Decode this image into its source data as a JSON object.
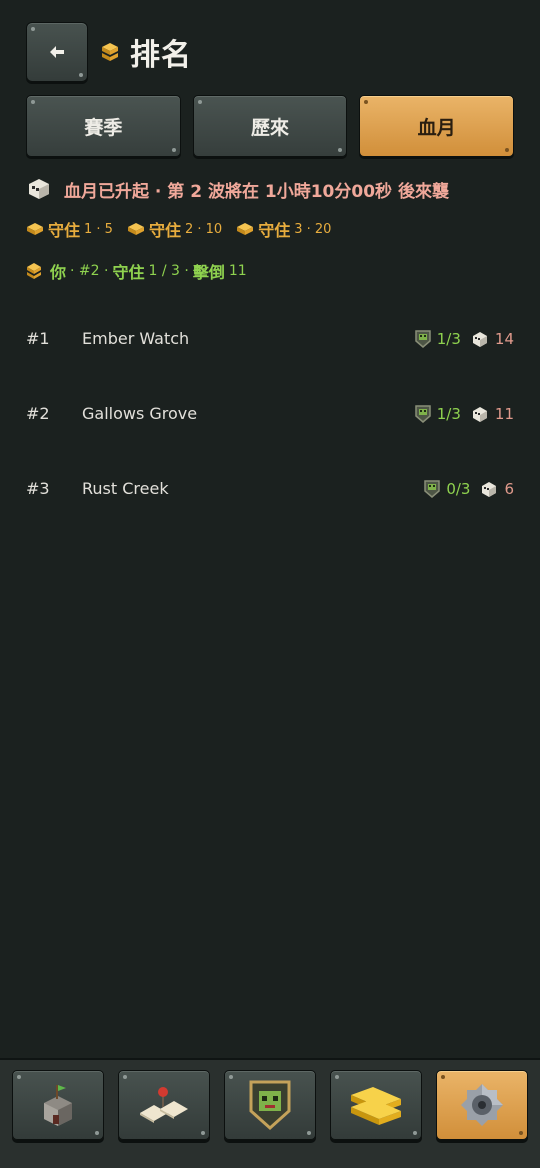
{
  "header": {
    "title": "排名",
    "back_icon": "arrow-left-icon",
    "title_icon": "gold-bar-icon"
  },
  "tabs": [
    {
      "label": "賽季",
      "active": false
    },
    {
      "label": "歷來",
      "active": false
    },
    {
      "label": "血月",
      "active": true
    }
  ],
  "blood_moon": {
    "text": "血月已升起 · 第 2 波將在 1小時10分00秒 後來襲",
    "icon": "skull-icon"
  },
  "rewards": [
    {
      "label": "守住",
      "value": "1 · 5"
    },
    {
      "label": "守住",
      "value": "2 · 10"
    },
    {
      "label": "守住",
      "value": "3 · 20"
    }
  ],
  "you": {
    "label": "你",
    "rank": "· #2 ·",
    "hold_label": "守住",
    "hold_value": "1 / 3 ·",
    "kill_label": "擊倒",
    "kill_value": "11"
  },
  "leaderboard": [
    {
      "rank": "#1",
      "name": "Ember Watch",
      "guard": "1/3",
      "kills": "14"
    },
    {
      "rank": "#2",
      "name": "Gallows Grove",
      "guard": "1/3",
      "kills": "11"
    },
    {
      "rank": "#3",
      "name": "Rust Creek",
      "guard": "0/3",
      "kills": "6"
    }
  ],
  "bottom_nav": [
    {
      "icon": "tower-icon",
      "active": false
    },
    {
      "icon": "map-pin-icon",
      "active": false
    },
    {
      "icon": "zombie-shield-icon",
      "active": false
    },
    {
      "icon": "gold-bars-icon",
      "active": false
    },
    {
      "icon": "gear-icon",
      "active": true
    }
  ],
  "colors": {
    "background": "#1b211f",
    "accent": "#d9a04a",
    "green": "#8fd24f",
    "salmon": "#f0a89a",
    "gold": "#e8ad3e"
  }
}
